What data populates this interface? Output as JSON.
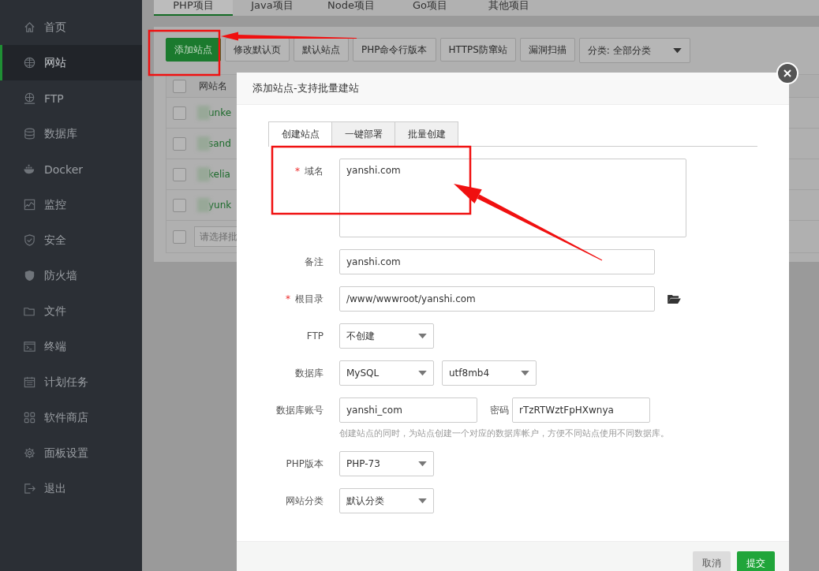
{
  "sidebar": {
    "items": [
      {
        "label": "首页",
        "selected": false
      },
      {
        "label": "网站",
        "selected": true
      },
      {
        "label": "FTP",
        "selected": false
      },
      {
        "label": "数据库",
        "selected": false
      },
      {
        "label": "Docker",
        "selected": false
      },
      {
        "label": "监控",
        "selected": false
      },
      {
        "label": "安全",
        "selected": false
      },
      {
        "label": "防火墙",
        "selected": false
      },
      {
        "label": "文件",
        "selected": false
      },
      {
        "label": "终端",
        "selected": false
      },
      {
        "label": "计划任务",
        "selected": false
      },
      {
        "label": "软件商店",
        "selected": false
      },
      {
        "label": "面板设置",
        "selected": false
      },
      {
        "label": "退出",
        "selected": false
      }
    ]
  },
  "project_tabs": [
    {
      "label": "PHP项目",
      "selected": true
    },
    {
      "label": "Java项目",
      "selected": false
    },
    {
      "label": "Node项目",
      "selected": false
    },
    {
      "label": "Go项目",
      "selected": false
    },
    {
      "label": "其他项目",
      "selected": false
    }
  ],
  "toolbar": [
    {
      "kind": "primary",
      "label": "添加站点"
    },
    {
      "kind": "button",
      "label": "修改默认页"
    },
    {
      "kind": "button",
      "label": "默认站点"
    },
    {
      "kind": "button",
      "label": "PHP命令行版本"
    },
    {
      "kind": "button",
      "label": "HTTPS防窜站"
    },
    {
      "kind": "button",
      "label": "漏洞扫描"
    },
    {
      "kind": "select",
      "label": "分类: 全部分类"
    }
  ],
  "table": {
    "columns": [
      "网站名"
    ],
    "header_checked": false,
    "footer_checked": false,
    "rows": [
      {
        "checked": false,
        "name": "unke"
      },
      {
        "checked": false,
        "name": "sand"
      },
      {
        "checked": false,
        "name": "kelia"
      },
      {
        "checked": false,
        "name": "yunk"
      }
    ],
    "batch_placeholder": "请选择批"
  },
  "dialog": {
    "title": "添加站点-支持批量建站",
    "tabs": [
      {
        "label": "创建站点",
        "selected": true
      },
      {
        "label": "一键部署",
        "selected": false
      },
      {
        "label": "批量创建",
        "selected": false
      }
    ],
    "fields": [
      {
        "label": "域名",
        "required_mark": "*",
        "controls": [
          {
            "kind": "textarea",
            "value": "yanshi.com"
          }
        ]
      },
      {
        "label": "备注",
        "controls": [
          {
            "kind": "input",
            "value": "yanshi.com"
          }
        ]
      },
      {
        "label": "根目录",
        "required_mark": "*",
        "controls": [
          {
            "kind": "path",
            "value": "/www/wwwroot/yanshi.com"
          }
        ]
      },
      {
        "label": "FTP",
        "controls": [
          {
            "kind": "select",
            "value": "不创建"
          }
        ]
      },
      {
        "label": "数据库",
        "controls": [
          {
            "kind": "select",
            "value": "MySQL"
          },
          {
            "kind": "select",
            "value": "utf8mb4"
          }
        ]
      },
      {
        "label": "数据库账号",
        "controls": [
          {
            "kind": "short-input",
            "value": "yanshi_com"
          },
          {
            "kind": "short-input",
            "label": "密码",
            "value": "rTzRTWztFpHXwnya"
          }
        ],
        "hint": "创建站点的同时，为站点创建一个对应的数据库帐户，方便不同站点使用不同数据库。"
      },
      {
        "label": "PHP版本",
        "controls": [
          {
            "kind": "select",
            "value": "PHP-73"
          }
        ]
      },
      {
        "label": "网站分类",
        "controls": [
          {
            "kind": "select",
            "value": "默认分类"
          }
        ]
      }
    ],
    "buttons": [
      {
        "kind": "cancel",
        "label": "取消"
      },
      {
        "kind": "submit",
        "label": "提交"
      }
    ]
  }
}
